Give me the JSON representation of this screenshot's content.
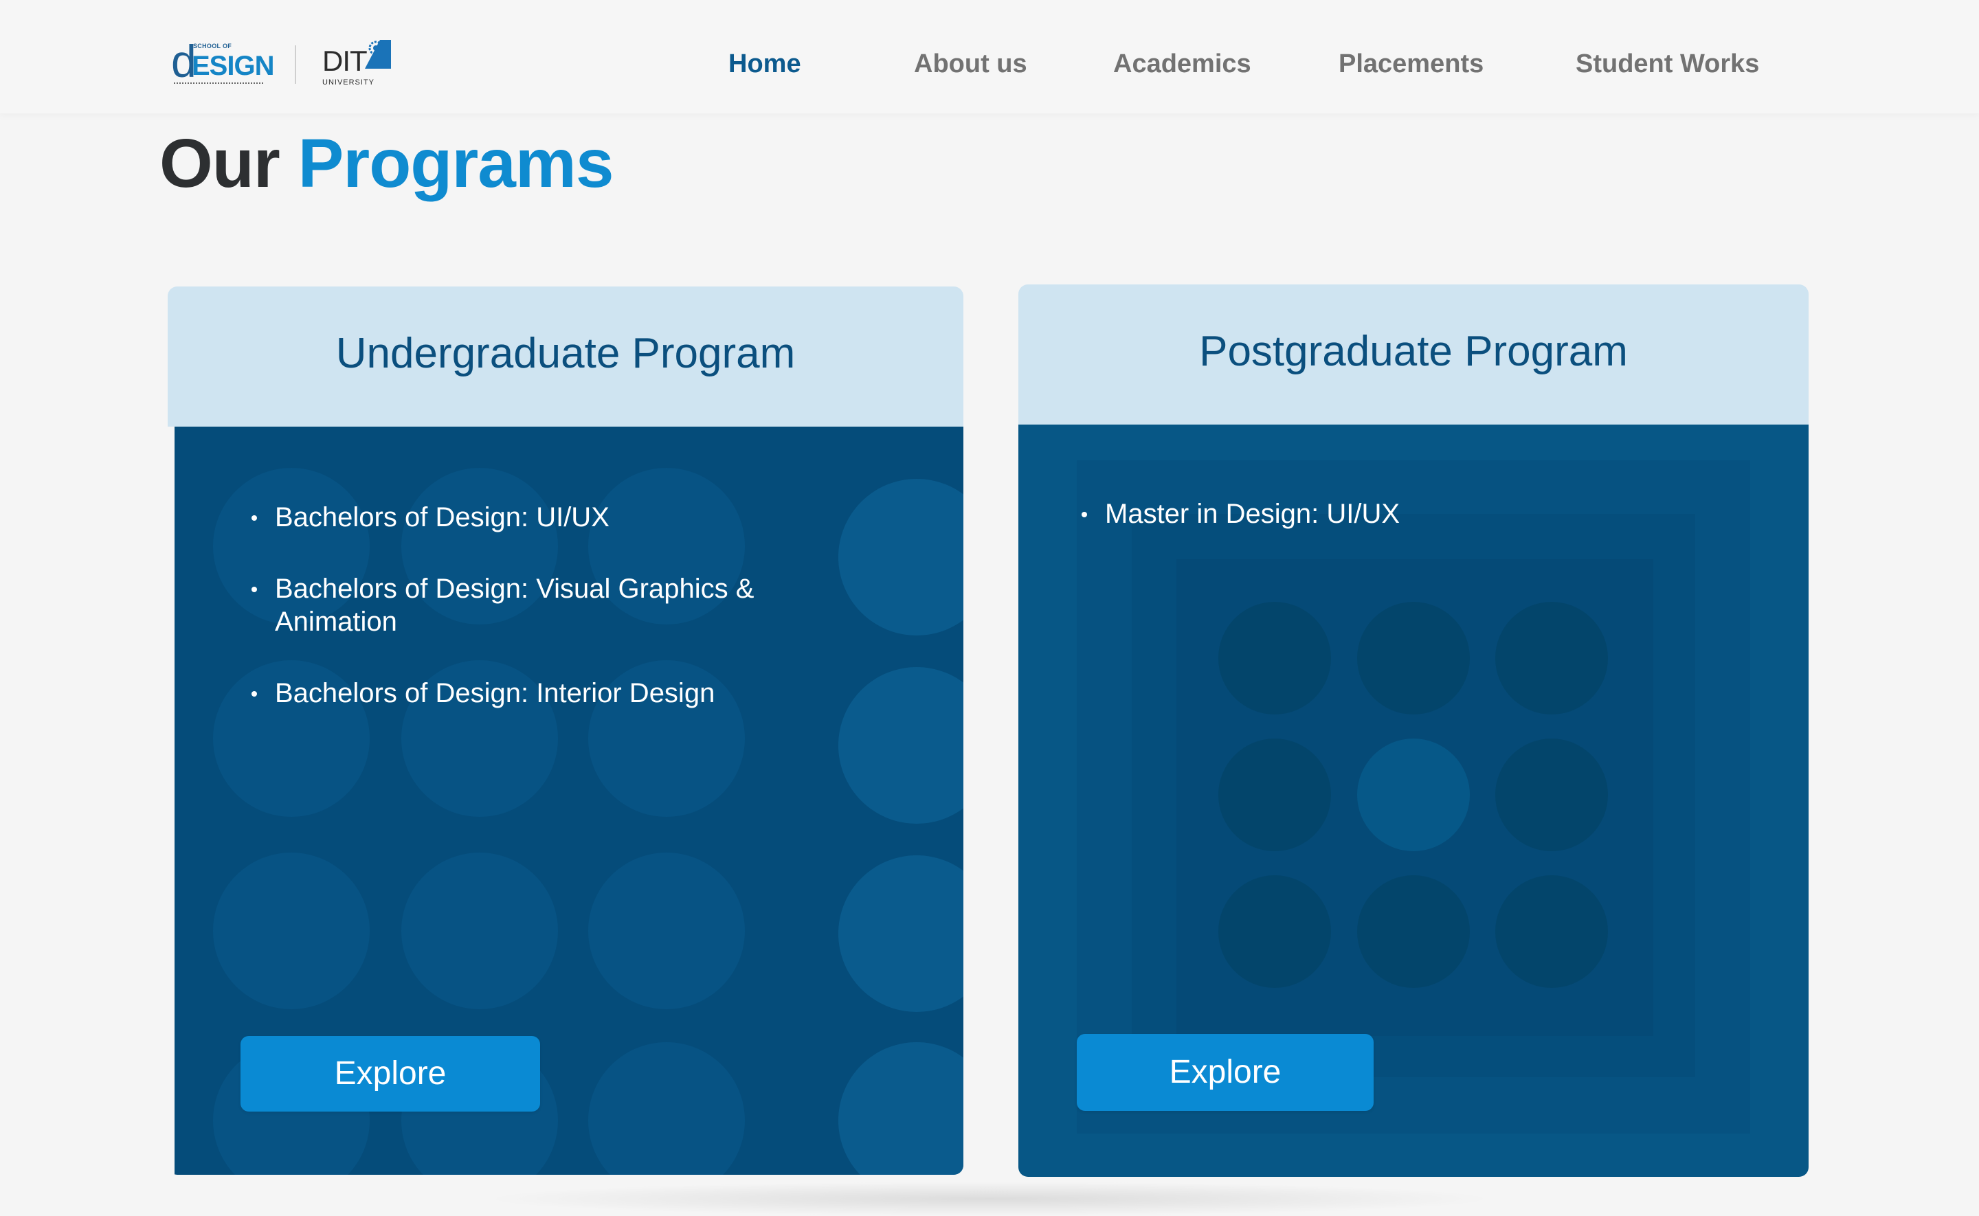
{
  "header": {
    "logo_sod": {
      "school_of": "SCHOOL OF",
      "d": "d",
      "esign": "ESIGN"
    },
    "logo_dit": {
      "name": "DIT",
      "sub": "UNIVERSITY"
    },
    "nav": [
      {
        "label": "Home",
        "active": true
      },
      {
        "label": "About us",
        "active": false
      },
      {
        "label": "Academics",
        "active": false
      },
      {
        "label": "Placements",
        "active": false
      },
      {
        "label": "Student Works",
        "active": false
      }
    ]
  },
  "title": {
    "part1": "Our",
    "part2": "Programs"
  },
  "cards": [
    {
      "title": "Undergraduate Program",
      "programs": [
        "Bachelors of Design: UI/UX",
        "Bachelors of Design: Visual Graphics & Animation",
        "Bachelors of Design: Interior Design"
      ],
      "button": "Explore"
    },
    {
      "title": "Postgraduate Program",
      "programs": [
        "Master in Design: UI/UX"
      ],
      "button": "Explore"
    }
  ],
  "colors": {
    "brand_blue": "#0f8bd0",
    "dark_blue": "#0c5a8e",
    "card_header": "#cfe4f1",
    "card_body": "#054c7a",
    "button": "#0a8ad3"
  },
  "icons": [
    "school-of-design-logo",
    "dit-university-logo",
    "bullet-icon"
  ]
}
